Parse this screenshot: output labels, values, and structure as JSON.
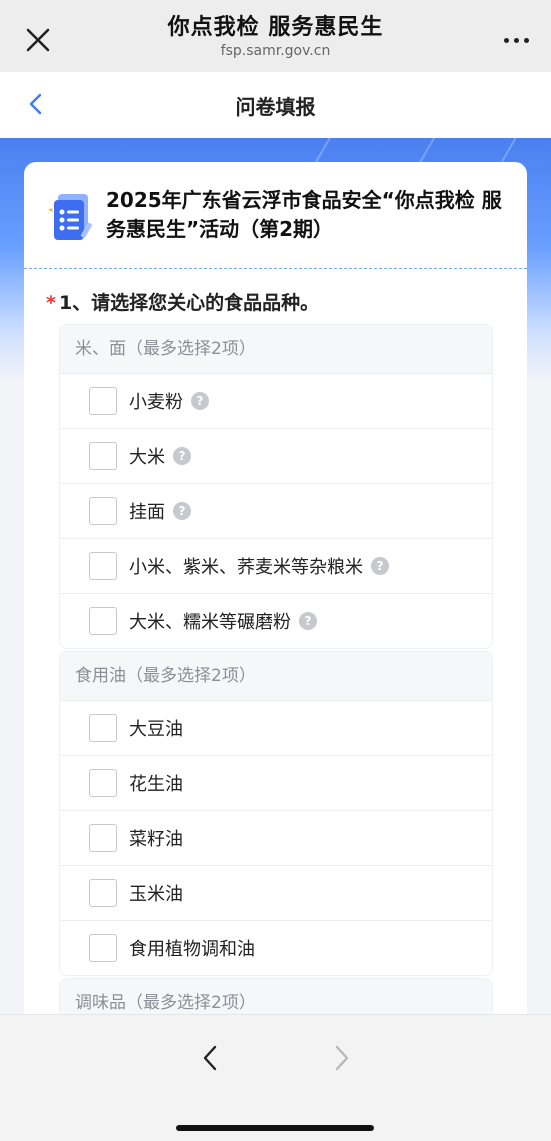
{
  "app": {
    "title": "你点我检 服务惠民生",
    "url": "fsp.samr.gov.cn"
  },
  "nav": {
    "title": "问卷填报"
  },
  "survey": {
    "title": "2025年广东省云浮市食品安全“你点我检 服务惠民生”活动（第2期）"
  },
  "question": {
    "required_mark": "*",
    "text": "1、请选择您关心的食品品种。"
  },
  "groups": [
    {
      "label": "米、面（最多选择2项）",
      "options": [
        {
          "label": "小麦粉",
          "help": "?"
        },
        {
          "label": "大米",
          "help": "?"
        },
        {
          "label": "挂面",
          "help": "?"
        },
        {
          "label": "小米、紫米、荞麦米等杂粮米",
          "help": "?"
        },
        {
          "label": "大米、糯米等碾磨粉",
          "help": "?"
        }
      ]
    },
    {
      "label": "食用油（最多选择2项）",
      "options": [
        {
          "label": "大豆油"
        },
        {
          "label": "花生油"
        },
        {
          "label": "菜籽油"
        },
        {
          "label": "玉米油"
        },
        {
          "label": "食用植物调和油"
        }
      ]
    },
    {
      "label": "调味品（最多选择2项）",
      "options": []
    }
  ],
  "colors": {
    "accent": "#3d7bf5",
    "required": "#e53935"
  },
  "icons": {
    "close": "close-icon",
    "more": "more-icon",
    "back": "chevron-left-icon",
    "help": "question-mark-icon",
    "survey": "survey-form-icon",
    "prev": "chevron-left-icon",
    "next": "chevron-right-icon"
  }
}
